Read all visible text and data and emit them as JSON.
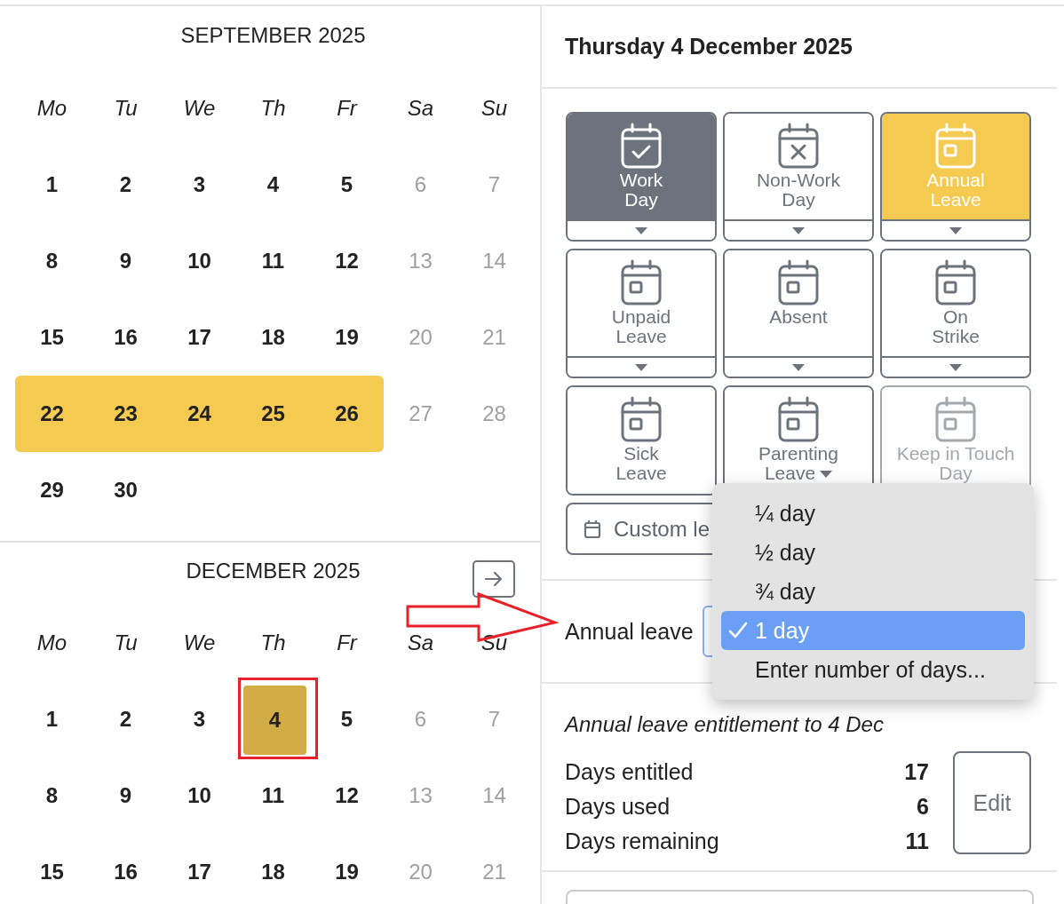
{
  "calendars": [
    {
      "title": "SEPTEMBER 2025",
      "next_button": false,
      "weekdays": [
        "Mo",
        "Tu",
        "We",
        "Th",
        "Fr",
        "Sa",
        "Su"
      ],
      "weeks": [
        [
          {
            "day": "1",
            "weekend": false,
            "in_range": false,
            "selected": false,
            "marked": false
          },
          {
            "day": "2",
            "weekend": false,
            "in_range": false,
            "selected": false,
            "marked": false
          },
          {
            "day": "3",
            "weekend": false,
            "in_range": false,
            "selected": false,
            "marked": false
          },
          {
            "day": "4",
            "weekend": false,
            "in_range": false,
            "selected": false,
            "marked": false
          },
          {
            "day": "5",
            "weekend": false,
            "in_range": false,
            "selected": false,
            "marked": false
          },
          {
            "day": "6",
            "weekend": true,
            "in_range": false,
            "selected": false,
            "marked": false
          },
          {
            "day": "7",
            "weekend": true,
            "in_range": false,
            "selected": false,
            "marked": false
          }
        ],
        [
          {
            "day": "8",
            "weekend": false,
            "in_range": false,
            "selected": false,
            "marked": false
          },
          {
            "day": "9",
            "weekend": false,
            "in_range": false,
            "selected": false,
            "marked": false
          },
          {
            "day": "10",
            "weekend": false,
            "in_range": false,
            "selected": false,
            "marked": false
          },
          {
            "day": "11",
            "weekend": false,
            "in_range": false,
            "selected": false,
            "marked": false
          },
          {
            "day": "12",
            "weekend": false,
            "in_range": false,
            "selected": false,
            "marked": false
          },
          {
            "day": "13",
            "weekend": true,
            "in_range": false,
            "selected": false,
            "marked": false
          },
          {
            "day": "14",
            "weekend": true,
            "in_range": false,
            "selected": false,
            "marked": false
          }
        ],
        [
          {
            "day": "15",
            "weekend": false,
            "in_range": false,
            "selected": false,
            "marked": false
          },
          {
            "day": "16",
            "weekend": false,
            "in_range": false,
            "selected": false,
            "marked": false
          },
          {
            "day": "17",
            "weekend": false,
            "in_range": false,
            "selected": false,
            "marked": false
          },
          {
            "day": "18",
            "weekend": false,
            "in_range": false,
            "selected": false,
            "marked": false
          },
          {
            "day": "19",
            "weekend": false,
            "in_range": false,
            "selected": false,
            "marked": false
          },
          {
            "day": "20",
            "weekend": true,
            "in_range": false,
            "selected": false,
            "marked": false
          },
          {
            "day": "21",
            "weekend": true,
            "in_range": false,
            "selected": false,
            "marked": false
          }
        ],
        [
          {
            "day": "22",
            "weekend": false,
            "in_range": true,
            "selected": false,
            "marked": false
          },
          {
            "day": "23",
            "weekend": false,
            "in_range": true,
            "selected": false,
            "marked": false
          },
          {
            "day": "24",
            "weekend": false,
            "in_range": true,
            "selected": false,
            "marked": false
          },
          {
            "day": "25",
            "weekend": false,
            "in_range": true,
            "selected": false,
            "marked": false
          },
          {
            "day": "26",
            "weekend": false,
            "in_range": true,
            "selected": false,
            "marked": false
          },
          {
            "day": "27",
            "weekend": true,
            "in_range": false,
            "selected": false,
            "marked": false
          },
          {
            "day": "28",
            "weekend": true,
            "in_range": false,
            "selected": false,
            "marked": false
          }
        ],
        [
          {
            "day": "29",
            "weekend": false,
            "in_range": false,
            "selected": false,
            "marked": false
          },
          {
            "day": "30",
            "weekend": false,
            "in_range": false,
            "selected": false,
            "marked": false
          }
        ]
      ]
    },
    {
      "title": "DECEMBER 2025",
      "next_button": true,
      "weekdays": [
        "Mo",
        "Tu",
        "We",
        "Th",
        "Fr",
        "Sa",
        "Su"
      ],
      "weeks": [
        [
          {
            "day": "1",
            "weekend": false,
            "in_range": false,
            "selected": false,
            "marked": false
          },
          {
            "day": "2",
            "weekend": false,
            "in_range": false,
            "selected": false,
            "marked": false
          },
          {
            "day": "3",
            "weekend": false,
            "in_range": false,
            "selected": false,
            "marked": false
          },
          {
            "day": "4",
            "weekend": false,
            "in_range": false,
            "selected": true,
            "marked": true
          },
          {
            "day": "5",
            "weekend": false,
            "in_range": false,
            "selected": false,
            "marked": false
          },
          {
            "day": "6",
            "weekend": true,
            "in_range": false,
            "selected": false,
            "marked": false
          },
          {
            "day": "7",
            "weekend": true,
            "in_range": false,
            "selected": false,
            "marked": false
          }
        ],
        [
          {
            "day": "8",
            "weekend": false,
            "in_range": false,
            "selected": false,
            "marked": false
          },
          {
            "day": "9",
            "weekend": false,
            "in_range": false,
            "selected": false,
            "marked": false
          },
          {
            "day": "10",
            "weekend": false,
            "in_range": false,
            "selected": false,
            "marked": false
          },
          {
            "day": "11",
            "weekend": false,
            "in_range": false,
            "selected": false,
            "marked": false
          },
          {
            "day": "12",
            "weekend": false,
            "in_range": false,
            "selected": false,
            "marked": false
          },
          {
            "day": "13",
            "weekend": true,
            "in_range": false,
            "selected": false,
            "marked": false
          },
          {
            "day": "14",
            "weekend": true,
            "in_range": false,
            "selected": false,
            "marked": false
          }
        ],
        [
          {
            "day": "15",
            "weekend": false,
            "in_range": false,
            "selected": false,
            "marked": false
          },
          {
            "day": "16",
            "weekend": false,
            "in_range": false,
            "selected": false,
            "marked": false
          },
          {
            "day": "17",
            "weekend": false,
            "in_range": false,
            "selected": false,
            "marked": false
          },
          {
            "day": "18",
            "weekend": false,
            "in_range": false,
            "selected": false,
            "marked": false
          },
          {
            "day": "19",
            "weekend": false,
            "in_range": false,
            "selected": false,
            "marked": false
          },
          {
            "day": "20",
            "weekend": true,
            "in_range": false,
            "selected": false,
            "marked": false
          },
          {
            "day": "21",
            "weekend": true,
            "in_range": false,
            "selected": false,
            "marked": false
          }
        ]
      ]
    }
  ],
  "annotation_arrow": true,
  "day_panel": {
    "title": "Thursday 4 December 2025",
    "leave_types": [
      {
        "label": "Work\nDay",
        "selected": true,
        "color": "#6c737c",
        "menu": true,
        "expanded": false,
        "disabled": false
      },
      {
        "label": "Non-Work\nDay",
        "selected": false,
        "color": "#ffffff",
        "menu": true,
        "expanded": false,
        "disabled": false
      },
      {
        "label": "Annual\nLeave",
        "selected": true,
        "color": "#f5ca50",
        "menu": true,
        "expanded": false,
        "disabled": false
      },
      {
        "label": "Unpaid\nLeave",
        "selected": false,
        "color": "#ffffff",
        "menu": true,
        "expanded": false,
        "disabled": false
      },
      {
        "label": "Absent",
        "selected": false,
        "color": "#ffffff",
        "menu": true,
        "expanded": false,
        "disabled": false
      },
      {
        "label": "On\nStrike",
        "selected": false,
        "color": "#ffffff",
        "menu": true,
        "expanded": false,
        "disabled": false
      },
      {
        "label": "Sick\nLeave",
        "selected": false,
        "color": "#ffffff",
        "menu": false,
        "expanded": false,
        "disabled": false
      },
      {
        "label": "Parenting\nLeave",
        "selected": false,
        "color": "#ffffff",
        "menu": false,
        "expanded": true,
        "disabled": false
      },
      {
        "label": "Keep in Touch\nDay",
        "selected": false,
        "color": "#ffffff",
        "menu": false,
        "expanded": false,
        "disabled": true
      }
    ],
    "custom_button": "Custom le",
    "amount_label": "Annual leave",
    "amount_menu": [
      {
        "label": "¼ day",
        "selected": false
      },
      {
        "label": "½ day",
        "selected": false
      },
      {
        "label": "¾ day",
        "selected": false
      },
      {
        "label": "1 day",
        "selected": true
      },
      {
        "label": "Enter number of days...",
        "selected": false
      }
    ],
    "entitlement": {
      "title": "Annual leave entitlement to 4 Dec",
      "rows": [
        {
          "label": "Days entitled",
          "value": "17"
        },
        {
          "label": "Days used",
          "value": "6"
        },
        {
          "label": "Days remaining",
          "value": "11"
        }
      ],
      "edit_button": "Edit"
    }
  }
}
